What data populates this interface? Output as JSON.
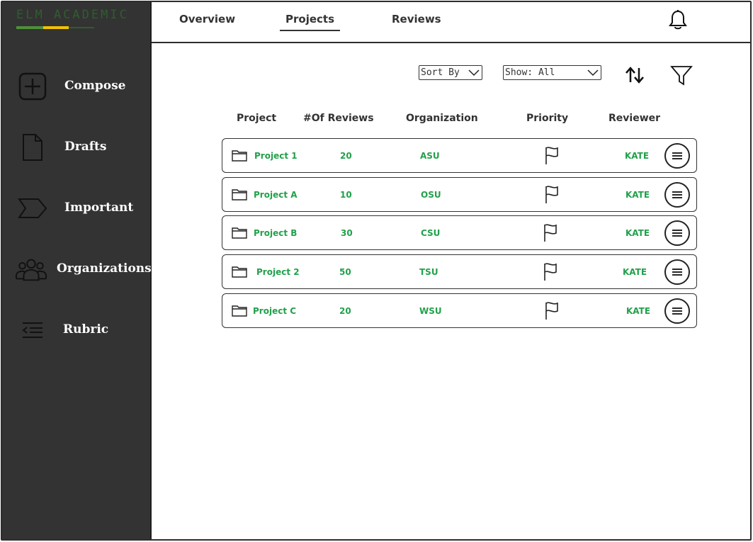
{
  "logo": {
    "text": "ELM ACADEMIC"
  },
  "sidebar": {
    "items": [
      {
        "label": "Compose",
        "icon": "plus-square-icon"
      },
      {
        "label": "Drafts",
        "icon": "document-icon"
      },
      {
        "label": "Important",
        "icon": "tag-icon"
      },
      {
        "label": "Organizations",
        "icon": "people-icon"
      },
      {
        "label": "Rubric",
        "icon": "list-indent-icon"
      }
    ]
  },
  "topnav": {
    "tabs": [
      {
        "label": "Overview"
      },
      {
        "label": "Projects",
        "active": true
      },
      {
        "label": "Reviews"
      }
    ],
    "icon": "bell-icon"
  },
  "toolbar": {
    "sort_by": "Sort By",
    "show": "Show: All"
  },
  "table": {
    "headers": [
      "Project",
      "#Of Reviews",
      "Organization",
      "Priority",
      "Reviewer"
    ],
    "rows": [
      {
        "project": "Project 1",
        "reviews": "20",
        "organization": "ASU",
        "reviewer": "KATE"
      },
      {
        "project": "Project A",
        "reviews": "10",
        "organization": "OSU",
        "reviewer": "KATE"
      },
      {
        "project": "Project B",
        "reviews": "30",
        "organization": "CSU",
        "reviewer": "KATE"
      },
      {
        "project": "Project 2",
        "reviews": "50",
        "organization": "TSU",
        "reviewer": "KATE"
      },
      {
        "project": "Project C",
        "reviews": "20",
        "organization": "WSU",
        "reviewer": "KATE"
      }
    ]
  },
  "colors": {
    "sidebar_bg": "#333333",
    "accent_green": "#22a04b",
    "logo_yellow": "#f2c200"
  }
}
